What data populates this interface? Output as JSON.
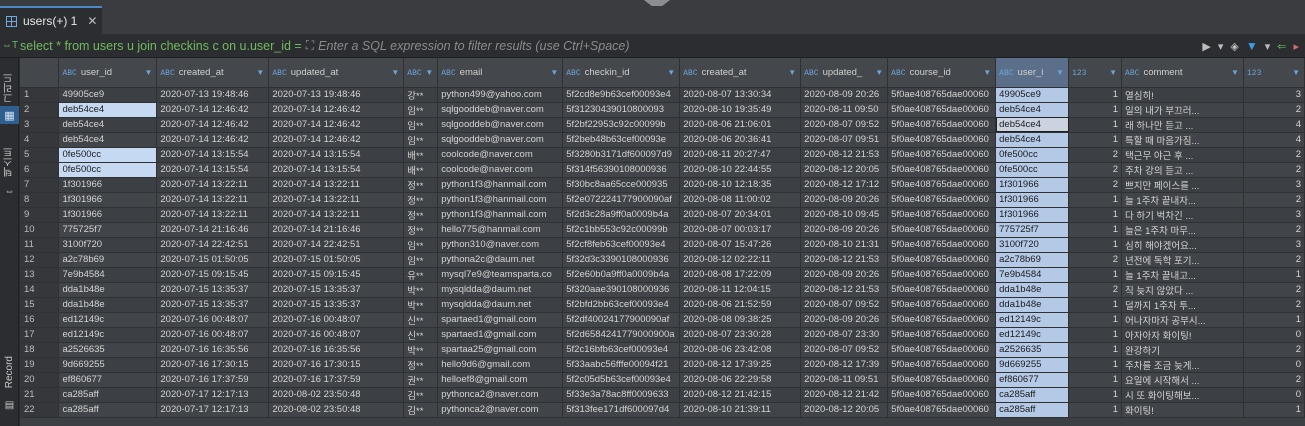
{
  "tab": {
    "title": "users(+) 1",
    "close": "✕"
  },
  "filter": {
    "sql": "select * from users u join checkins c on u.user_id =",
    "placeholder": "Enter a SQL expression to filter results (use Ctrl+Space)"
  },
  "vtoolbar": {
    "grid_label": "그리드",
    "text_label": "텍스트",
    "record_label": "Record"
  },
  "columns": [
    {
      "type": "ABC",
      "name": "user_id"
    },
    {
      "type": "ABC",
      "name": "created_at"
    },
    {
      "type": "ABC",
      "name": "updated_at"
    },
    {
      "type": "ABC",
      "name": ""
    },
    {
      "type": "ABC",
      "name": "email"
    },
    {
      "type": "ABC",
      "name": "checkin_id"
    },
    {
      "type": "ABC",
      "name": "created_at"
    },
    {
      "type": "ABC",
      "name": "updated_"
    },
    {
      "type": "ABC",
      "name": "course_id"
    },
    {
      "type": "ABC",
      "name": "user_i"
    },
    {
      "type": "123",
      "name": ""
    },
    {
      "type": "ABC",
      "name": "comment"
    },
    {
      "type": "123",
      "name": ""
    }
  ],
  "rows": [
    [
      "1",
      "49905ce9",
      "2020-07-13 19:48:46",
      "2020-07-13 19:48:46",
      "강**",
      "python499@yahoo.com",
      "5f2cd8e9b63cef00093e4",
      "2020-08-07 13:30:34",
      "2020-08-09 20:26",
      "5f0ae408765dae00060",
      "49905ce9",
      "1",
      "열심히!",
      "3"
    ],
    [
      "2",
      "deb54ce4",
      "2020-07-14 12:46:42",
      "2020-07-14 12:46:42",
      "임**",
      "sqlgooddeb@naver.com",
      "5f31230439010800093",
      "2020-08-10 19:35:49",
      "2020-08-11 09:50",
      "5f0ae408765dae00060",
      "deb54ce4",
      "1",
      "일의 내가 부끄러...",
      "2"
    ],
    [
      "3",
      "deb54ce4",
      "2020-07-14 12:46:42",
      "2020-07-14 12:46:42",
      "임**",
      "sqlgooddeb@naver.com",
      "5f2bf22953c92c00099b",
      "2020-08-06 21:06:01",
      "2020-08-07 09:52",
      "5f0ae408765dae00060",
      "deb54ce4",
      "1",
      "래 하나만 듣고 ...",
      "4"
    ],
    [
      "4",
      "deb54ce4",
      "2020-07-14 12:46:42",
      "2020-07-14 12:46:42",
      "임**",
      "sqlgooddeb@naver.com",
      "5f2beb48b63cef00093e",
      "2020-08-06 20:36:41",
      "2020-08-07 09:51",
      "5f0ae408765dae00060",
      "deb54ce4",
      "1",
      "특할 때 마음가짐...",
      "4"
    ],
    [
      "5",
      "0fe500cc",
      "2020-07-14 13:15:54",
      "2020-07-14 13:15:54",
      "배**",
      "coolcode@naver.com",
      "5f3280b3171df600097d9",
      "2020-08-11 20:27:47",
      "2020-08-12 21:53",
      "5f0ae408765dae00060",
      "0fe500cc",
      "2",
      "택근무 야근 후 ...",
      "2"
    ],
    [
      "6",
      "0fe500cc",
      "2020-07-14 13:15:54",
      "2020-07-14 13:15:54",
      "배**",
      "coolcode@naver.com",
      "5f314f56390108000936",
      "2020-08-10 22:44:55",
      "2020-08-12 20:05",
      "5f0ae408765dae00060",
      "0fe500cc",
      "2",
      "주차 강의 듣고 ...",
      "2"
    ],
    [
      "7",
      "1f301966",
      "2020-07-14 13:22:11",
      "2020-07-14 13:22:11",
      "정**",
      "python1f3@hanmail.com",
      "5f30bc8aa65cce000935",
      "2020-08-10 12:18:35",
      "2020-08-12 17:12",
      "5f0ae408765dae00060",
      "1f301966",
      "2",
      "쁘지만 페이스를 ...",
      "3"
    ],
    [
      "8",
      "1f301966",
      "2020-07-14 13:22:11",
      "2020-07-14 13:22:11",
      "정**",
      "python1f3@hanmail.com",
      "5f2e072224177900090af",
      "2020-08-08 11:00:02",
      "2020-08-09 20:26",
      "5f0ae408765dae00060",
      "1f301966",
      "1",
      "늘 1주차 끝내자...",
      "2"
    ],
    [
      "9",
      "1f301966",
      "2020-07-14 13:22:11",
      "2020-07-14 13:22:11",
      "정**",
      "python1f3@hanmail.com",
      "5f2d3c28a9ff0a0009b4a",
      "2020-08-07 20:34:01",
      "2020-08-10 09:45",
      "5f0ae408765dae00060",
      "1f301966",
      "1",
      "다 하기 벅차긴 ...",
      "3"
    ],
    [
      "10",
      "775725f7",
      "2020-07-14 21:16:46",
      "2020-07-14 21:16:46",
      "정**",
      "hello775@hanmail.com",
      "5f2c1bb553c92c00099b",
      "2020-08-07 00:03:17",
      "2020-08-09 20:26",
      "5f0ae408765dae00060",
      "775725f7",
      "1",
      "늘은 1주차 마무...",
      "2"
    ],
    [
      "11",
      "3100f720",
      "2020-07-14 22:42:51",
      "2020-07-14 22:42:51",
      "임**",
      "python310@naver.com",
      "5f2cf8feb63cef00093e4",
      "2020-08-07 15:47:26",
      "2020-08-10 21:31",
      "5f0ae408765dae00060",
      "3100f720",
      "1",
      "심히 해야겠어요...",
      "3"
    ],
    [
      "12",
      "a2c78b69",
      "2020-07-15 01:50:05",
      "2020-07-15 01:50:05",
      "임**",
      "pythona2c@daum.net",
      "5f32d3c3390108000936",
      "2020-08-12 02:22:11",
      "2020-08-12 21:53",
      "5f0ae408765dae00060",
      "a2c78b69",
      "2",
      "년전에 독학 포기...",
      "2"
    ],
    [
      "13",
      "7e9b4584",
      "2020-07-15 09:15:45",
      "2020-07-15 09:15:45",
      "유**",
      "mysql7e9@teamsparta.co",
      "5f2e60b0a9ff0a0009b4a",
      "2020-08-08 17:22:09",
      "2020-08-09 20:26",
      "5f0ae408765dae00060",
      "7e9b4584",
      "1",
      "늘 1주차 끝내고...",
      "1"
    ],
    [
      "14",
      "dda1b48e",
      "2020-07-15 13:35:37",
      "2020-07-15 13:35:37",
      "박**",
      "mysqldda@daum.net",
      "5f320aae390108000936",
      "2020-08-11 12:04:15",
      "2020-08-12 21:53",
      "5f0ae408765dae00060",
      "dda1b48e",
      "2",
      "직 늦지 않았다 ...",
      "2"
    ],
    [
      "15",
      "dda1b48e",
      "2020-07-15 13:35:37",
      "2020-07-15 13:35:37",
      "박**",
      "mysqldda@daum.net",
      "5f2bfd2bb63cef00093e4",
      "2020-08-06 21:52:59",
      "2020-08-07 09:52",
      "5f0ae408765dae00060",
      "dda1b48e",
      "1",
      "덜까지 1주차 투...",
      "2"
    ],
    [
      "16",
      "ed12149c",
      "2020-07-16 00:48:07",
      "2020-07-16 00:48:07",
      "신**",
      "spartaed1@gmail.com",
      "5f2df40024177900090af",
      "2020-08-08 09:38:25",
      "2020-08-09 20:26",
      "5f0ae408765dae00060",
      "ed12149c",
      "1",
      "어나자마자 공부시...",
      "1"
    ],
    [
      "17",
      "ed12149c",
      "2020-07-16 00:48:07",
      "2020-07-16 00:48:07",
      "신**",
      "spartaed1@gmail.com",
      "5f2d6584241779000900a",
      "2020-08-07 23:30:28",
      "2020-08-07 23:30",
      "5f0ae408765dae00060",
      "ed12149c",
      "1",
      "아자아자 화이팅!",
      "0"
    ],
    [
      "18",
      "a2526635",
      "2020-07-16 16:35:56",
      "2020-07-16 16:35:56",
      "박**",
      "spartaa25@gmail.com",
      "5f2c16bfb63cef00093e4",
      "2020-08-06 23:42:08",
      "2020-08-07 09:52",
      "5f0ae408765dae00060",
      "a2526635",
      "1",
      "완강하기",
      "2"
    ],
    [
      "19",
      "9d669255",
      "2020-07-16 17:30:15",
      "2020-07-16 17:30:15",
      "정**",
      "hello9d6@gmail.com",
      "5f33aabc56fffe00094f21",
      "2020-08-12 17:39:25",
      "2020-08-12 17:39",
      "5f0ae408765dae00060",
      "9d669255",
      "1",
      "주차를 조금 늦게...",
      "0"
    ],
    [
      "20",
      "ef860677",
      "2020-07-16 17:37:59",
      "2020-07-16 17:37:59",
      "권**",
      "helloef8@gmail.com",
      "5f2c05d5b63cef00093e4",
      "2020-08-06 22:29:58",
      "2020-08-11 09:51",
      "5f0ae408765dae00060",
      "ef860677",
      "1",
      "요일에 시작해서 ...",
      "2"
    ],
    [
      "21",
      "ca285aff",
      "2020-07-17 12:17:13",
      "2020-08-02 23:50:48",
      "김**",
      "pythonca2@naver.com",
      "5f33e3a78ac8ff0009633",
      "2020-08-12 21:42:15",
      "2020-08-12 21:42",
      "5f0ae408765dae00060",
      "ca285aff",
      "1",
      "시 또 화이팅해보...",
      "0"
    ],
    [
      "22",
      "ca285aff",
      "2020-07-17 12:17:13",
      "2020-08-02 23:50:48",
      "김**",
      "pythonca2@naver.com",
      "5f313fee171df600097d4",
      "2020-08-10 21:39:11",
      "2020-08-12 20:05",
      "5f0ae408765dae00060",
      "ca285aff",
      "1",
      "화이팅!",
      "1"
    ]
  ]
}
